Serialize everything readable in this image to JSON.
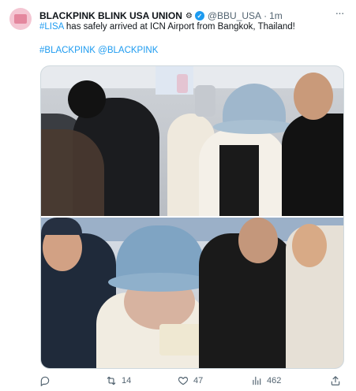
{
  "tweet": {
    "author_name": "BLACKPINK BLINK USA UNION",
    "author_emoji": "⚙",
    "handle": "@BBU_USA",
    "separator": "·",
    "time": "1m",
    "more_label": "···",
    "text": {
      "hashtag": "#LISA",
      "body": " has safely arrived at ICN Airport from Bangkok, Thailand!"
    },
    "tags": {
      "tag1": "#BLACKPINK",
      "tag2": "@BLACKPINK"
    }
  },
  "actions": {
    "reply_count": "",
    "retweet_count": "14",
    "like_count": "47",
    "views_count": "462"
  }
}
